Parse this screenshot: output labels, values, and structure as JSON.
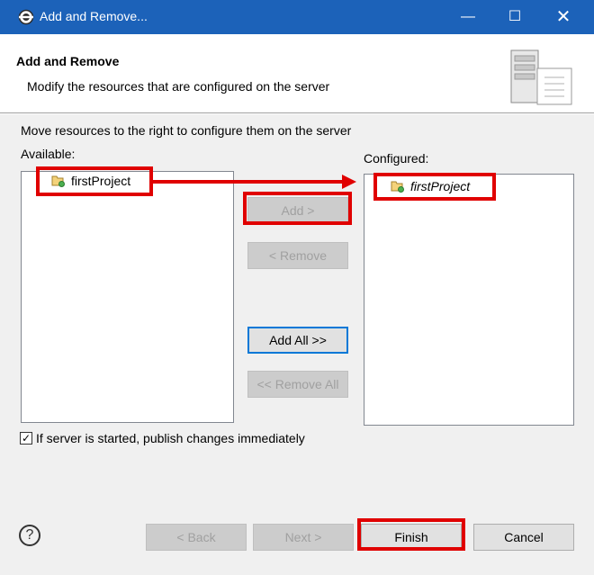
{
  "window": {
    "title": "Add and Remove...",
    "minimize_glyph": "—",
    "maximize_glyph": "☐",
    "close_glyph": "✕"
  },
  "header": {
    "title": "Add and Remove",
    "description": "Modify the resources that are configured on the server"
  },
  "instructions": "Move resources to the right to configure them on the server",
  "available": {
    "label": "Available:",
    "items": [
      "firstProject"
    ]
  },
  "configured": {
    "label": "Configured:",
    "items": [
      "firstProject"
    ]
  },
  "buttons": {
    "add": "Add >",
    "remove": "< Remove",
    "add_all": "Add All >>",
    "remove_all": "<< Remove All"
  },
  "publish_checkbox": {
    "label": "If server is started, publish changes immediately",
    "checked": true,
    "check_glyph": "✓"
  },
  "footer": {
    "help_glyph": "?",
    "back": "< Back",
    "next": "Next >",
    "finish": "Finish",
    "cancel": "Cancel"
  },
  "colors": {
    "titlebar": "#1c62b9",
    "highlight": "#e00000",
    "default_button_border": "#0078d7"
  }
}
